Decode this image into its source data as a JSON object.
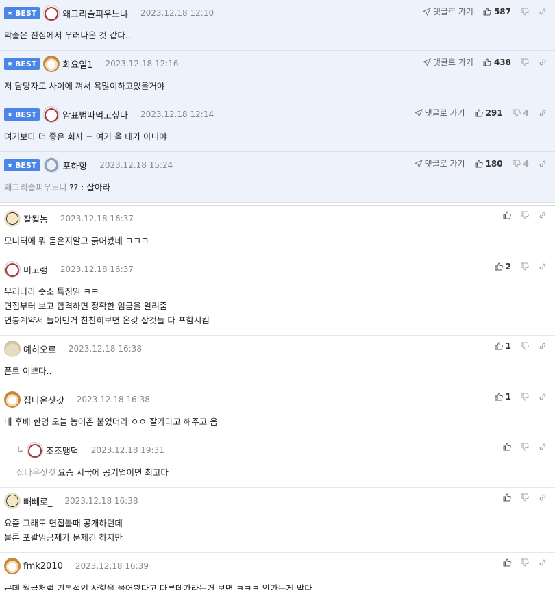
{
  "labels": {
    "best": "BEST",
    "goto": "댓글로 가기"
  },
  "best_comments": [
    {
      "nick": "왜그리슬피우느냐",
      "date": "2023.12.18 12:10",
      "avatar": "panda",
      "up": "587",
      "down": "",
      "lines": [
        "막줄은 진심에서 우러나온 것 같다.."
      ]
    },
    {
      "nick": "화요일1",
      "date": "2023.12.18 12:16",
      "avatar": "fox",
      "up": "438",
      "down": "",
      "lines": [
        "저 담당자도 사이에 껴서 욕많이하고있을거야"
      ]
    },
    {
      "nick": "암표범따먹고싶다",
      "date": "2023.12.18 12:14",
      "avatar": "panda",
      "up": "291",
      "down": "4",
      "lines": [
        "여기보다 더 좋은 회사 = 여기 올 데가 아니야"
      ]
    },
    {
      "nick": "포하항",
      "date": "2023.12.18 15:24",
      "avatar": "cat",
      "up": "180",
      "down": "4",
      "mention": "왜그리슬피우느냐",
      "lines": [
        "?? : 살아라"
      ]
    }
  ],
  "comments": [
    {
      "nick": "잘될놈",
      "date": "2023.12.18 16:37",
      "avatar": "pup",
      "up": "",
      "down": "",
      "lines": [
        "모니터에 뭐 묻은지알고 긁어봤네 ㅋㅋㅋ"
      ]
    },
    {
      "nick": "미고랭",
      "date": "2023.12.18 16:37",
      "avatar": "panda",
      "up": "2",
      "down": "",
      "lines": [
        "우리나라 좆소 특징임 ㅋㅋ",
        "면접부터 보고 합격하면 정확한 임금을 알려줌",
        "연봉계약서 들이민거 찬찬히보면 온갖 잡것들 다 포함시킴"
      ]
    },
    {
      "nick": "예히오르",
      "date": "2023.12.18 16:38",
      "avatar": "blob",
      "up": "1",
      "down": "",
      "lines": [
        "폰트 이쁘다.."
      ]
    },
    {
      "nick": "집나온삿갓",
      "date": "2023.12.18 16:38",
      "avatar": "fox",
      "up": "1",
      "down": "",
      "lines": [
        "내 후배 한명 오늘 농어촌 붙었더라 ㅇㅇ 잘가라고 해주고 옴"
      ]
    },
    {
      "nick": "조조맹덕",
      "date": "2023.12.18 19:31",
      "avatar": "panda",
      "reply": true,
      "up": "",
      "down": "",
      "mention": "집나온삿갓",
      "lines": [
        "요즘 시국에 공기업이면 최고다"
      ]
    },
    {
      "nick": "빼빼로_",
      "date": "2023.12.18 16:38",
      "avatar": "pup",
      "up": "",
      "down": "",
      "lines": [
        "요즘 그래도 면접볼때 공개하던데",
        "물론 포괄임금제가 문제긴 하지만"
      ]
    },
    {
      "nick": "fmk2010",
      "date": "2023.12.18 16:39",
      "avatar": "fox",
      "up": "",
      "down": "",
      "lines": [
        "근데 월급처럼 기본적인 사항을 물어봤다고 다른데가라는거 보면 ㅋㅋㅋ 안가는게 맞다"
      ]
    }
  ]
}
